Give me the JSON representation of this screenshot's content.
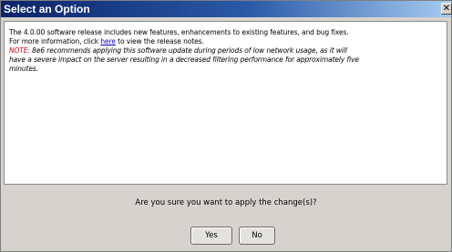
{
  "window": {
    "title": "Select an Option",
    "close_glyph": "✕"
  },
  "message": {
    "line1": "The 4.0.00 software release includes new features, enhancements to existing features, and bug fixes.",
    "line2_before": "For more information, click ",
    "line2_link": "here",
    "line2_after": " to view the release notes.",
    "note_label": "NOTE:",
    "note_line1": " 8e6 recommends applying this software update during periods of low network usage, as it will",
    "note_line2": "have a severe impact on the server resulting in a decreased filtering performance for approximately five",
    "note_line3": "minutes."
  },
  "prompt": {
    "question": "Are you sure you want to apply the change(s)?",
    "yes_label": "Yes",
    "no_label": "No"
  },
  "colors": {
    "title_bar": "#0a246a",
    "note": "#d40000",
    "link": "#0000cc"
  }
}
